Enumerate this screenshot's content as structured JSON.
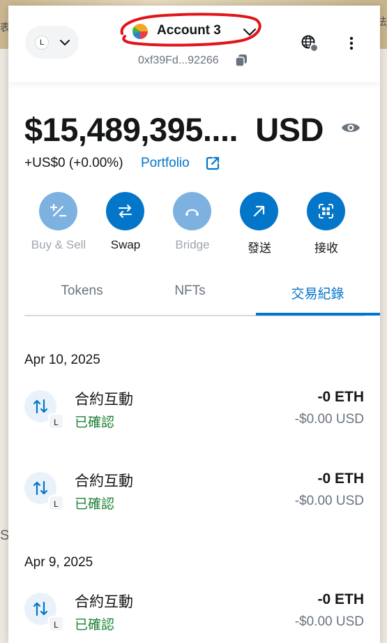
{
  "background": {
    "left_fragment": "表",
    "right_fragment": "法",
    "side_letter": "S"
  },
  "header": {
    "network_badge": "L",
    "account_name": "Account 3",
    "address": "0xf39Fd...92266",
    "icons": {
      "network_chevron": "chevron-down-icon",
      "account_chevron": "chevron-down-icon",
      "copy": "copy-icon",
      "globe": "globe-icon",
      "menu": "more-vertical-icon"
    }
  },
  "balance": {
    "amount": "$15,489,395....",
    "currency": "USD",
    "change": "+US$0 (+0.00%)",
    "portfolio_label": "Portfolio"
  },
  "actions": [
    {
      "label": "Buy & Sell",
      "icon": "plus-minus-icon",
      "enabled": false
    },
    {
      "label": "Swap",
      "icon": "swap-arrows-icon",
      "enabled": true
    },
    {
      "label": "Bridge",
      "icon": "bridge-icon",
      "enabled": false
    },
    {
      "label": "發送",
      "icon": "send-arrow-icon",
      "enabled": true
    },
    {
      "label": "接收",
      "icon": "qr-receive-icon",
      "enabled": true
    }
  ],
  "tabs": [
    {
      "label": "Tokens",
      "active": false
    },
    {
      "label": "NFTs",
      "active": false
    },
    {
      "label": "交易紀錄",
      "active": true
    }
  ],
  "activity": {
    "groups": [
      {
        "date": "Apr 10, 2025",
        "items": [
          {
            "title": "合約互動",
            "status": "已確認",
            "amount": "-0 ETH",
            "fiat": "-$0.00 USD",
            "badge": "L"
          },
          {
            "title": "合約互動",
            "status": "已確認",
            "amount": "-0 ETH",
            "fiat": "-$0.00 USD",
            "badge": "L"
          }
        ]
      },
      {
        "date": "Apr 9, 2025",
        "items": [
          {
            "title": "合約互動",
            "status": "已確認",
            "amount": "-0 ETH",
            "fiat": "-$0.00 USD",
            "badge": "L"
          }
        ]
      }
    ]
  },
  "colors": {
    "accent": "#0376c9",
    "accent_disabled": "#7cb1e0",
    "success": "#1c8234",
    "muted": "#6a737d",
    "annotation": "#e0151b"
  }
}
